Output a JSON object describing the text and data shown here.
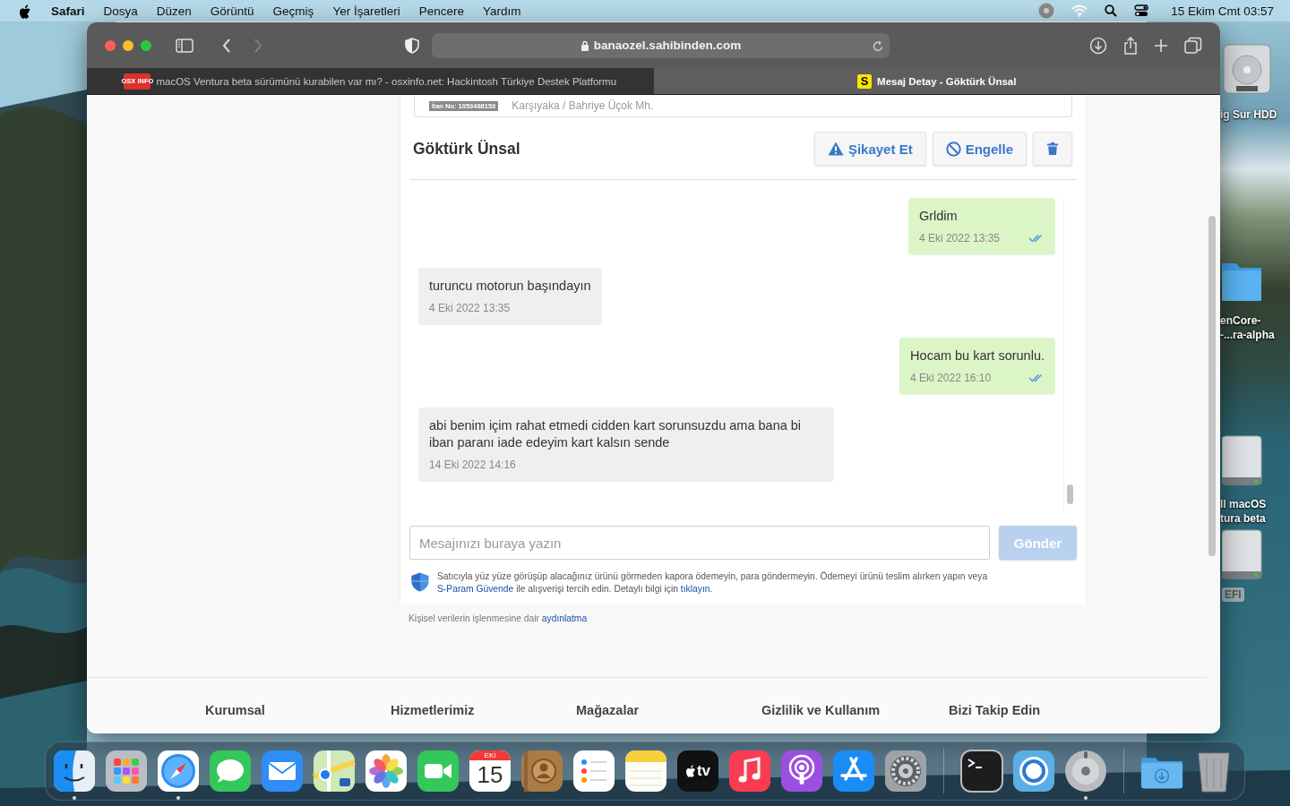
{
  "menu_bar": {
    "app": "Safari",
    "menus": [
      "Dosya",
      "Düzen",
      "Görüntü",
      "Geçmiş",
      "Yer İşaretleri",
      "Pencere",
      "Yardım"
    ],
    "clock": "15 Ekim Cmt  03:57"
  },
  "desktop_icons": [
    {
      "kind": "drive",
      "label_lines": [
        "ig Sur HDD"
      ]
    },
    {
      "kind": "folder",
      "label_lines": [
        "enCore-",
        "-...ra-alpha"
      ]
    },
    {
      "kind": "external-drive",
      "label_lines": [
        "ll macOS",
        "tura beta"
      ]
    },
    {
      "kind": "external-drive",
      "label_lines": [
        "EFI"
      ]
    }
  ],
  "browser": {
    "url": "banaozel.sahibinden.com",
    "forward_disabled": true,
    "tabs": [
      {
        "favicon": "OSX INFO",
        "kind": "osx",
        "title": "macOS Ventura beta sürümünü kurabilen var mı? - osxinfo.net: Hackintosh Türkiye Destek Platformu",
        "selected": false
      },
      {
        "favicon": "S",
        "kind": "s",
        "title": "Mesaj Detay - Göktürk Ünsal",
        "selected": true
      }
    ]
  },
  "listing": {
    "ilan_no": "İlan No: 1053488153",
    "location": "Karşıyaka / Bahriye Üçok Mh."
  },
  "conversation": {
    "contact": "Göktürk Ünsal",
    "actions": [
      {
        "kind": "report",
        "label": "Şikayet Et"
      },
      {
        "kind": "block",
        "label": "Engelle"
      },
      {
        "kind": "delete"
      }
    ],
    "messages": [
      {
        "kind": "sent",
        "text": "Grldim",
        "time": "4 Eki 2022 13:35",
        "read": true
      },
      {
        "kind": "received",
        "text": "turuncu motorun başındayın",
        "time": "4 Eki 2022 13:35"
      },
      {
        "kind": "sent",
        "text": "Hocam bu kart sorunlu.",
        "time": "4 Eki 2022 16:10",
        "read": true
      },
      {
        "kind": "received",
        "text": "abi benim içim rahat etmedi cidden kart sorunsuzdu ama bana bi iban paranı iade edeyim kart kalsın sende",
        "time": "14 Eki 2022 14:16"
      }
    ],
    "composer": {
      "placeholder": "Mesajınızı buraya yazın",
      "send": "Gönder",
      "send_disabled": true
    },
    "notice": {
      "before": "Satıcıyla yüz yüze görüşüp alacağınız ürünü görmeden kapora ödemeyin, para göndermeyin. Ödemeyi ürünü teslim alırken yapın veya ",
      "link": "S-Param Güvende",
      "middle": " ile alışverişi tercih edin. Detaylı bilgi için ",
      "link2": "tıklayın",
      "after": "."
    }
  },
  "privacy": {
    "text": "Kişisel verilerin işlenmesine dair ",
    "link": "aydınlatma"
  },
  "footer": [
    "Kurumsal",
    "Hizmetlerimiz",
    "Mağazalar",
    "Gizlilik ve Kullanım",
    "Bizi Takip Edin"
  ],
  "dock": [
    {
      "kind": "finder",
      "running": true
    },
    {
      "kind": "launchpad",
      "running": false
    },
    {
      "kind": "safari",
      "running": true
    },
    {
      "kind": "messages",
      "running": false
    },
    {
      "kind": "mail",
      "running": false
    },
    {
      "kind": "maps",
      "running": false
    },
    {
      "kind": "photos",
      "running": false
    },
    {
      "kind": "facetime",
      "running": false
    },
    {
      "kind": "calendar",
      "month": "EKİ",
      "day": "15",
      "running": false
    },
    {
      "kind": "contacts",
      "running": false
    },
    {
      "kind": "reminders",
      "running": false
    },
    {
      "kind": "notes",
      "running": false
    },
    {
      "kind": "tv",
      "label": "tv",
      "running": false
    },
    {
      "kind": "music",
      "running": false
    },
    {
      "kind": "podcasts",
      "running": false
    },
    {
      "kind": "appstore",
      "running": false
    },
    {
      "kind": "settings",
      "running": false
    },
    {
      "kind": "divider"
    },
    {
      "kind": "terminal",
      "running": false
    },
    {
      "kind": "ring",
      "running": false
    },
    {
      "kind": "disc",
      "running": true
    },
    {
      "kind": "divider"
    },
    {
      "kind": "downloads",
      "running": false
    },
    {
      "kind": "trash",
      "running": false
    }
  ]
}
